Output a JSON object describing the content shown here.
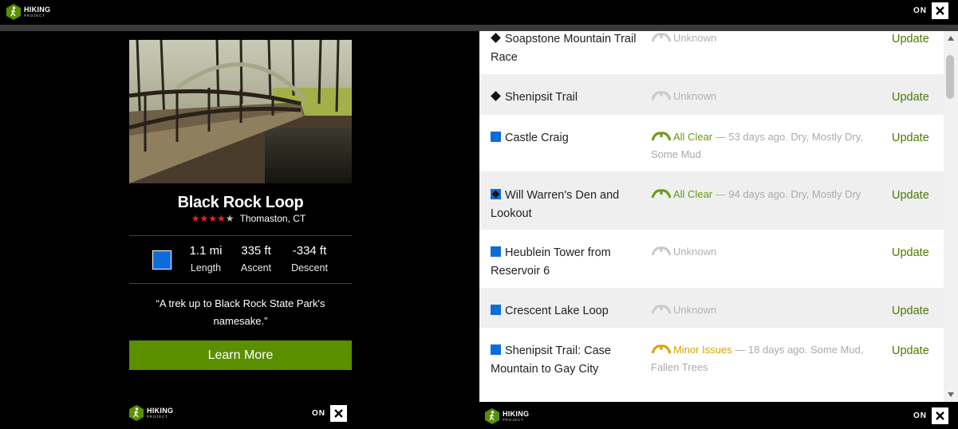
{
  "header": {
    "logo": {
      "line1": "HIKING",
      "line2": "PROJECT"
    },
    "toggle_label": "ON",
    "close_icon": "close-icon"
  },
  "trail_card": {
    "name": "Black Rock Loop",
    "rating": 4,
    "rating_max": 5,
    "location": "Thomaston, CT",
    "difficulty_color": "#0d6dd8",
    "stats": [
      {
        "value": "1.1 mi",
        "label": "Length"
      },
      {
        "value": "335 ft",
        "label": "Ascent"
      },
      {
        "value": "-334 ft",
        "label": "Descent"
      }
    ],
    "quote": "“A trek up to Black Rock State Park's namesake.”",
    "cta_label": "Learn More",
    "accent_color": "#5a8f00"
  },
  "left_footer": {
    "logo": {
      "line1": "HIKING",
      "line2": "PROJECT"
    },
    "toggle_label": "ON"
  },
  "right_footer": {
    "logo": {
      "line1": "HIKING",
      "line2": "PROJECT"
    },
    "toggle_label": "ON"
  },
  "conditions": {
    "update_label": "Update",
    "rows": [
      {
        "difficulty": "black-diamond",
        "name": "Soapstone Mountain Trail Race",
        "status": "Unknown",
        "detail": ""
      },
      {
        "difficulty": "black-diamond",
        "name": "Shenipsit Trail",
        "status": "Unknown",
        "detail": ""
      },
      {
        "difficulty": "blue-square",
        "name": "Castle Craig",
        "status": "All Clear",
        "detail": " — 53 days ago. Dry, Mostly Dry, Some Mud"
      },
      {
        "difficulty": "blue-black",
        "name": "Will Warren's Den and Lookout",
        "status": "All Clear",
        "detail": " — 94 days ago. Dry, Mostly Dry"
      },
      {
        "difficulty": "blue-square",
        "name": "Heublein Tower from Reservoir 6",
        "status": "Unknown",
        "detail": ""
      },
      {
        "difficulty": "blue-square",
        "name": "Crescent Lake Loop",
        "status": "Unknown",
        "detail": ""
      },
      {
        "difficulty": "blue-square",
        "name": "Shenipsit Trail: Case Mountain to Gay City",
        "status": "Minor Issues",
        "detail": " — 18 days ago. Some Mud, Fallen Trees"
      }
    ]
  }
}
